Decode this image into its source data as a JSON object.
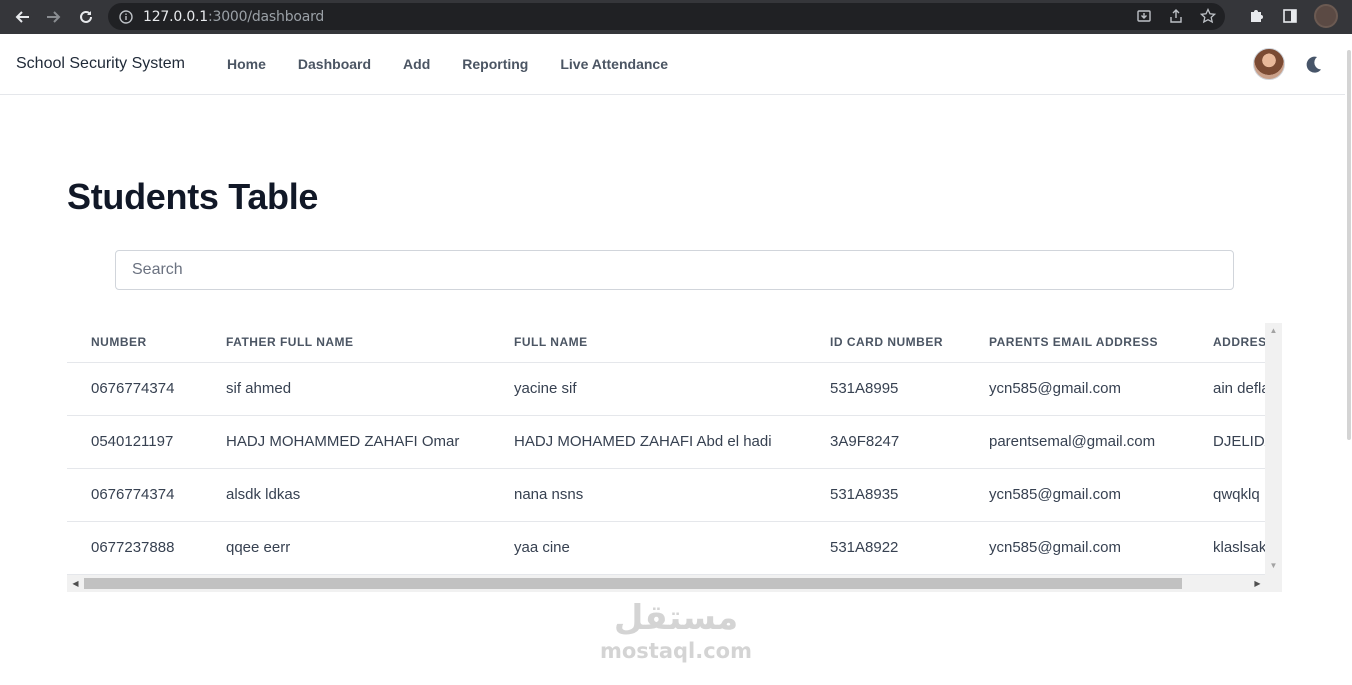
{
  "browser": {
    "url_host": "127.0.0.1",
    "url_path": ":3000/dashboard"
  },
  "navbar": {
    "brand": "School Security System",
    "links": [
      "Home",
      "Dashboard",
      "Add",
      "Reporting",
      "Live Attendance"
    ]
  },
  "page": {
    "title": "Students Table",
    "search_placeholder": "Search"
  },
  "table": {
    "columns": [
      "NUMBER",
      "FATHER FULL NAME",
      "FULL NAME",
      "ID CARD NUMBER",
      "PARENTS EMAIL ADDRESS",
      "ADDRESS"
    ],
    "rows": [
      [
        "0676774374",
        "sif ahmed",
        "yacine sif",
        "531A8995",
        "ycn585@gmail.com",
        "ain defla"
      ],
      [
        "0540121197",
        "HADJ MOHAMMED ZAHAFI Omar",
        "HADJ MOHAMED ZAHAFI Abd el hadi",
        "3A9F8247",
        "parentsemal@gmail.com",
        "DJELIDA"
      ],
      [
        "0676774374",
        "alsdk ldkas",
        "nana nsns",
        "531A8935",
        "ycn585@gmail.com",
        "qwqklq"
      ],
      [
        "0677237888",
        "qqee eerr",
        "yaa cine",
        "531A8922",
        "ycn585@gmail.com",
        "klaslsak"
      ]
    ]
  },
  "watermark": {
    "arabic": "مستقل",
    "latin": "mostaql.com"
  },
  "icons": {
    "back": "back-arrow-icon",
    "forward": "forward-arrow-icon",
    "reload": "reload-icon",
    "theme": "moon-icon"
  }
}
